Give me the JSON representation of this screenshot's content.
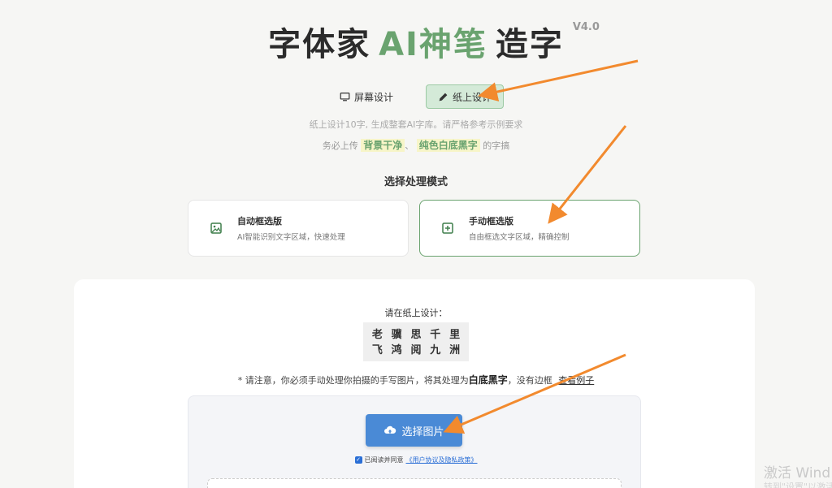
{
  "header": {
    "title_part1": "字体家",
    "title_accent": "AI神笔",
    "title_part2": "造字",
    "version": "V4.0"
  },
  "tabs": [
    {
      "label": "屏幕设计",
      "icon": "monitor-icon",
      "active": false
    },
    {
      "label": "纸上设计",
      "icon": "pencil-icon",
      "active": true
    }
  ],
  "description": {
    "line1": "纸上设计10字, 生成整套AI字库。请严格参考示例要求",
    "line2_prefix": "务必上传",
    "highlight1": "背景干净",
    "separator": "、",
    "highlight2": "纯色白底黑字",
    "line2_suffix": "的字搞"
  },
  "section_title": "选择处理模式",
  "modes": [
    {
      "title": "自动框选版",
      "subtitle": "AI智能识别文字区域，快速处理",
      "icon": "image-icon"
    },
    {
      "title": "手动框选版",
      "subtitle": "自由框选文字区域，精确控制",
      "icon": "add-box-icon",
      "selected": true
    }
  ],
  "upload": {
    "prompt": "请在纸上设计：",
    "sample_row1": [
      "老",
      "骥",
      "思",
      "千",
      "里"
    ],
    "sample_row2": [
      "飞",
      "鸿",
      "阅",
      "九",
      "洲"
    ],
    "notice_prefix": "* 请注意，你必须手动处理你拍摄的手写图片，将其处理为",
    "notice_bold": "白底黑字",
    "notice_suffix": "，没有边框",
    "example_link": "查看例子",
    "button_label": "选择图片",
    "agree_text": "已阅读并同意",
    "agree_link": "《用户协议及隐私政策》"
  },
  "watermark": {
    "line1": "激活 Wind",
    "line2": "转到\"设置\"以激活"
  },
  "colors": {
    "accent_green": "#6aa36f",
    "button_blue": "#4a8ad6",
    "arrow_orange": "#f28a2e"
  }
}
